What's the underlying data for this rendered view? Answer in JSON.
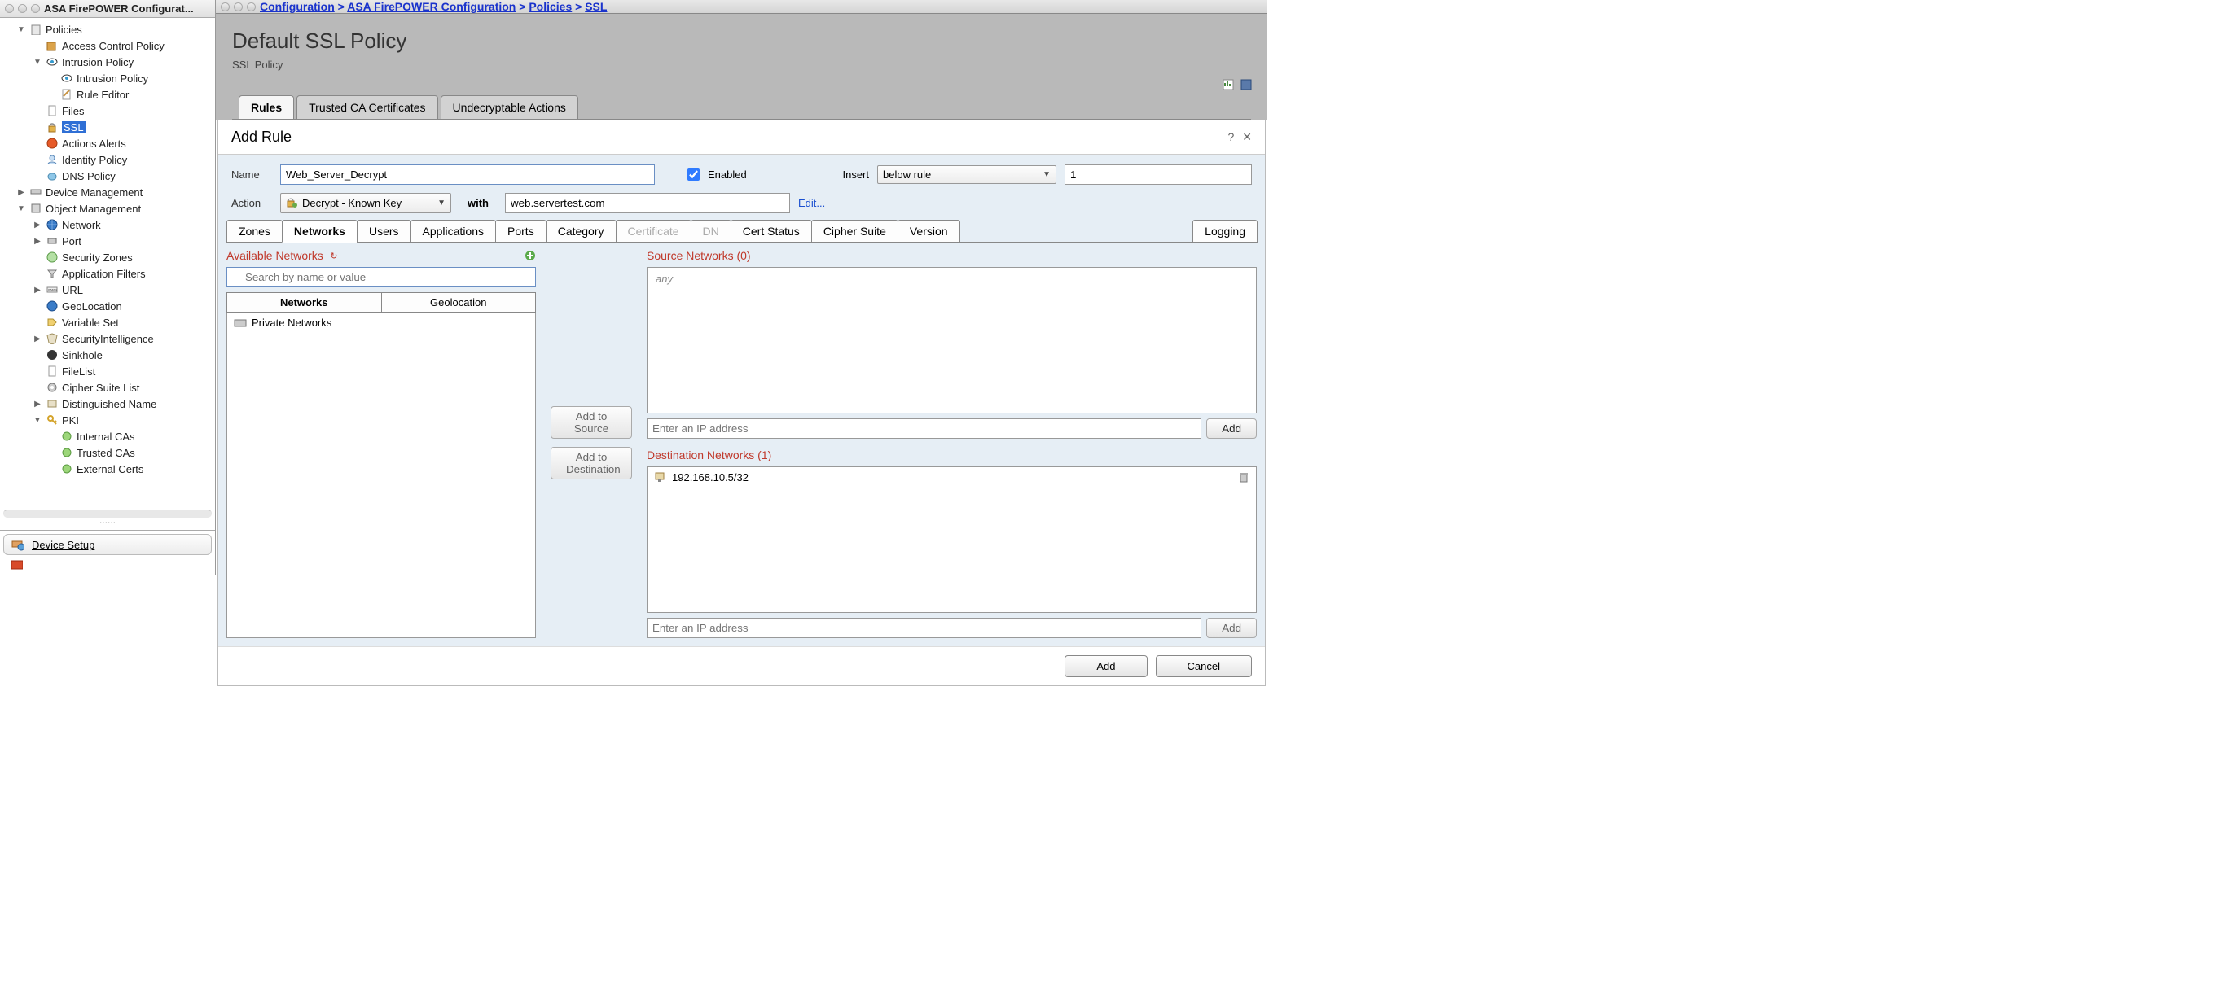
{
  "sidebar": {
    "window_title": "ASA FirePOWER Configurat...",
    "tree": {
      "policies": "Policies",
      "acp": "Access Control Policy",
      "intrusion": "Intrusion Policy",
      "intrusion_sub": "Intrusion Policy",
      "rule_editor": "Rule Editor",
      "files": "Files",
      "ssl": "SSL",
      "actions_alerts": "Actions Alerts",
      "identity": "Identity Policy",
      "dns": "DNS Policy",
      "device_mgmt": "Device Management",
      "object_mgmt": "Object Management",
      "network": "Network",
      "port": "Port",
      "sec_zones": "Security Zones",
      "app_filters": "Application Filters",
      "url": "URL",
      "geolocation": "GeoLocation",
      "var_set": "Variable Set",
      "sec_intel": "SecurityIntelligence",
      "sinkhole": "Sinkhole",
      "filelist": "FileList",
      "cipher_list": "Cipher Suite List",
      "dn": "Distinguished Name",
      "pki": "PKI",
      "internal_cas": "Internal CAs",
      "trusted_cas": "Trusted CAs",
      "external_certs": "External Certs"
    },
    "bottom_btn": "Device Setup"
  },
  "breadcrumbs": {
    "b1": "Configuration",
    "b2": "ASA FirePOWER Configuration",
    "b3": "Policies",
    "b4": "SSL"
  },
  "policy": {
    "title": "Default SSL Policy",
    "subtitle": "SSL Policy"
  },
  "policy_tabs": {
    "rules": "Rules",
    "trusted": "Trusted CA Certificates",
    "undecrypt": "Undecryptable Actions"
  },
  "rule": {
    "header": "Add Rule",
    "name_label": "Name",
    "name_value": "Web_Server_Decrypt",
    "enabled_label": "Enabled",
    "insert_label": "Insert",
    "insert_mode": "below rule",
    "insert_num": "1",
    "action_label": "Action",
    "action_value": "Decrypt - Known Key",
    "with_label": "with",
    "with_value": "web.servertest.com",
    "edit": "Edit..."
  },
  "inner_tabs": {
    "zones": "Zones",
    "networks": "Networks",
    "users": "Users",
    "apps": "Applications",
    "ports": "Ports",
    "category": "Category",
    "cert": "Certificate",
    "dn": "DN",
    "cert_status": "Cert Status",
    "cipher": "Cipher Suite",
    "version": "Version",
    "logging": "Logging"
  },
  "nets": {
    "avail_title": "Available Networks",
    "search_placeholder": "Search by name or value",
    "subtab_net": "Networks",
    "subtab_geo": "Geolocation",
    "list_item_1": "Private Networks",
    "add_src": "Add to Source",
    "add_dst": "Add to Destination",
    "src_title": "Source Networks (0)",
    "src_any": "any",
    "dst_title": "Destination Networks (1)",
    "dst_item_1": "192.168.10.5/32",
    "ip_placeholder": "Enter an IP address",
    "add_btn": "Add"
  },
  "footer": {
    "add": "Add",
    "cancel": "Cancel"
  }
}
